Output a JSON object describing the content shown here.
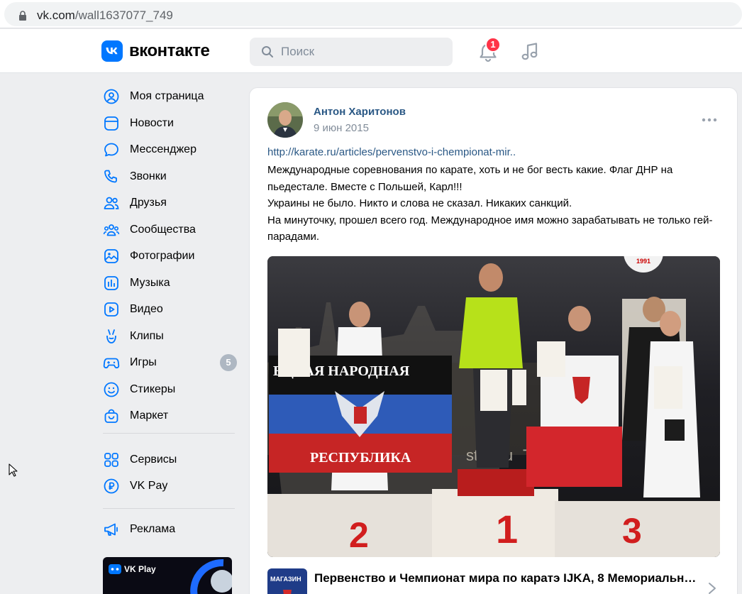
{
  "browser": {
    "url_domain": "vk.com",
    "url_path": "/wall1637077_749"
  },
  "header": {
    "logo_text": "вконтакте",
    "search_placeholder": "Поиск",
    "notifications_count": "1"
  },
  "sidebar": {
    "items": [
      {
        "label": "Моя страница",
        "icon": "user-circle-icon"
      },
      {
        "label": "Новости",
        "icon": "news-icon"
      },
      {
        "label": "Мессенджер",
        "icon": "message-icon"
      },
      {
        "label": "Звонки",
        "icon": "phone-icon"
      },
      {
        "label": "Друзья",
        "icon": "friends-icon"
      },
      {
        "label": "Сообщества",
        "icon": "communities-icon"
      },
      {
        "label": "Фотографии",
        "icon": "photo-icon"
      },
      {
        "label": "Музыка",
        "icon": "music-icon"
      },
      {
        "label": "Видео",
        "icon": "video-icon"
      },
      {
        "label": "Клипы",
        "icon": "clips-icon"
      },
      {
        "label": "Игры",
        "icon": "games-icon",
        "count": "5"
      },
      {
        "label": "Стикеры",
        "icon": "smile-icon"
      },
      {
        "label": "Маркет",
        "icon": "market-icon"
      }
    ],
    "secondary": [
      {
        "label": "Сервисы",
        "icon": "services-icon"
      },
      {
        "label": "VK Pay",
        "icon": "vkpay-icon"
      }
    ],
    "ads": {
      "label": "Реклама",
      "icon": "megaphone-icon"
    },
    "promo_text": "VK Play"
  },
  "post": {
    "author": "Антон Харитонов",
    "date": "9 июн 2015",
    "link": "http://karate.ru/articles/pervenstvo-i-chempionat-mir..",
    "text": "Международные соревнования по карате, хоть и не бог весть какие. Флаг ДНР на пьедестале. Вместе с Польшей, Карл!!!\nУкраины не было. Никто и слова не сказал. Никаких санкций.\nНа минуточку, прошел всего год. Международное имя можно зарабатывать не только гей-парадами.",
    "photo": {
      "flag_text_top": "ЕЦКАЯ НАРОДНАЯ",
      "flag_text_bottom": "РЕСПУБЛИКА",
      "podium_numbers": [
        "2",
        "1",
        "3"
      ],
      "backdrop_text": "stanbu",
      "backdrop_text_2": "TU",
      "badge_text": "1991"
    },
    "attachment": {
      "thumb_text": "МАГАЗИН",
      "title": "Первенство и Чемпионат мира по каратэ IJKA, 8 Мемориальны..."
    }
  },
  "colors": {
    "vk_blue": "#0077ff",
    "link": "#2a5885",
    "badge_red": "#ff3347"
  }
}
